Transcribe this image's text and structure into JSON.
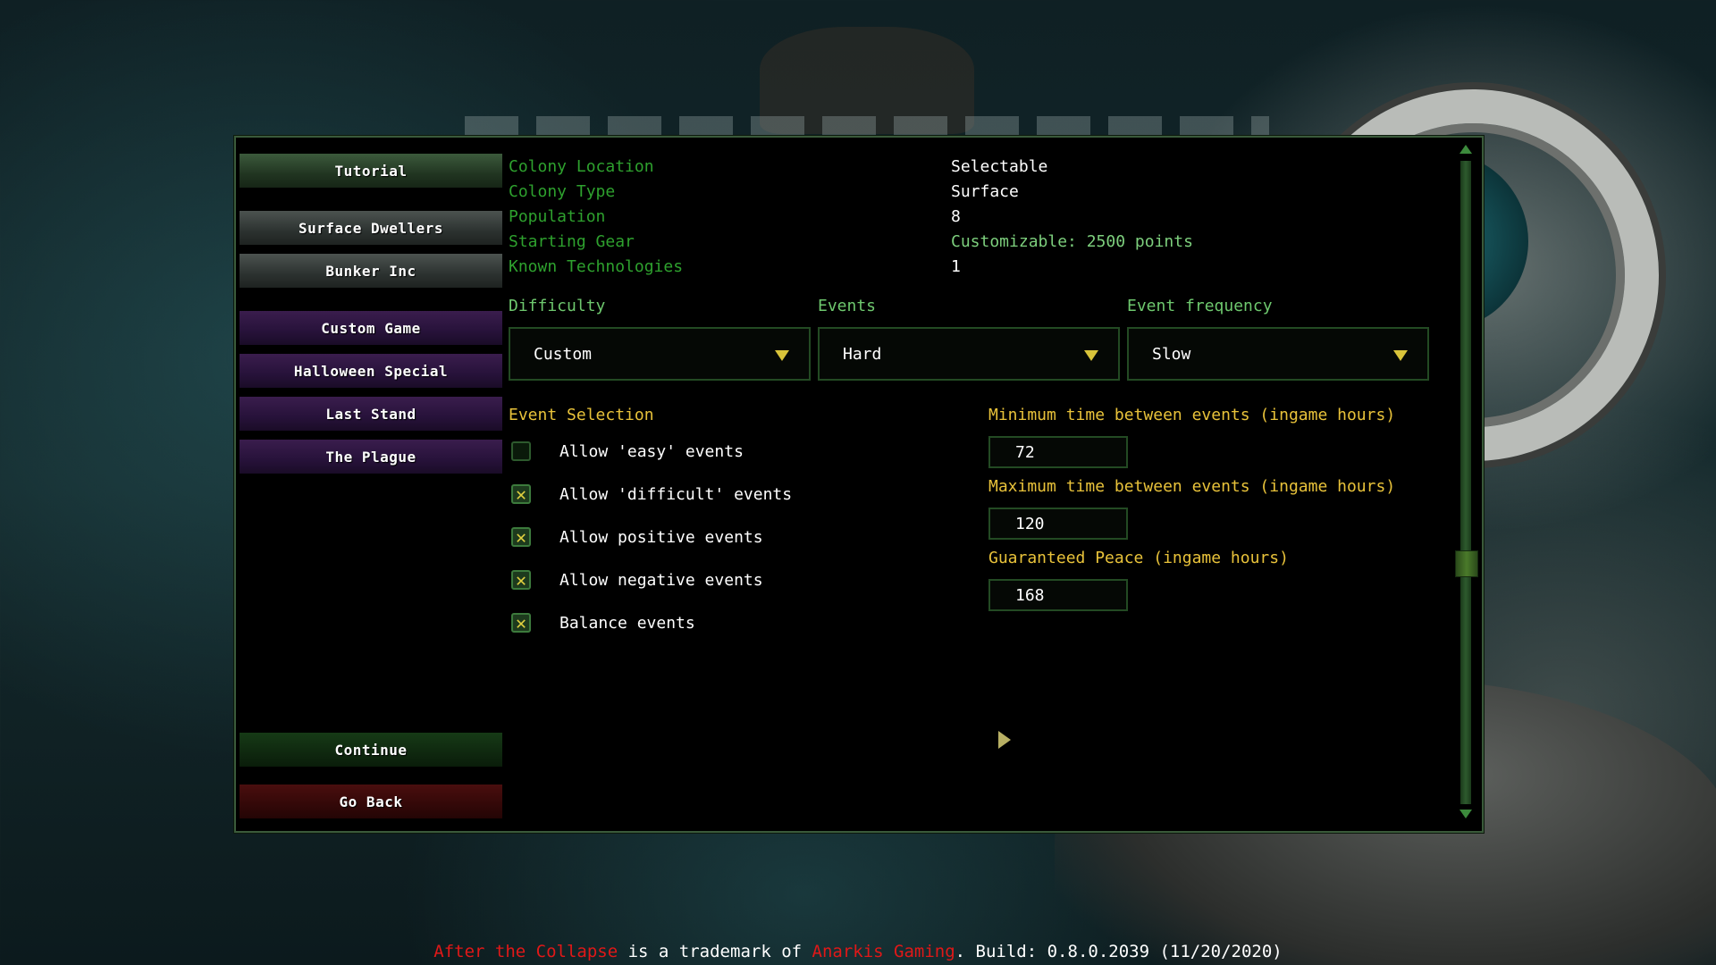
{
  "menu": {
    "tutorial": "Tutorial",
    "surface_dwellers": "Surface Dwellers",
    "bunker_inc": "Bunker Inc",
    "custom_game": "Custom Game",
    "halloween_special": "Halloween Special",
    "last_stand": "Last Stand",
    "the_plague": "The Plague",
    "continue": "Continue",
    "go_back": "Go Back"
  },
  "info": {
    "rows": [
      {
        "label": "Colony Location",
        "value": "Selectable"
      },
      {
        "label": "Colony Type",
        "value": "Surface"
      },
      {
        "label": "Population",
        "value": "8"
      },
      {
        "label": "Starting Gear",
        "value": "Customizable: 2500 points"
      },
      {
        "label": "Known Technologies",
        "value": "1"
      }
    ]
  },
  "settings": {
    "difficulty_label": "Difficulty",
    "difficulty_value": "Custom",
    "events_label": "Events",
    "events_value": "Hard",
    "frequency_label": "Event frequency",
    "frequency_value": "Slow"
  },
  "event_selection": {
    "title": "Event Selection",
    "options": [
      {
        "label": "Allow 'easy' events",
        "checked": false
      },
      {
        "label": "Allow 'difficult' events",
        "checked": true
      },
      {
        "label": "Allow positive events",
        "checked": true
      },
      {
        "label": "Allow negative events",
        "checked": true
      },
      {
        "label": "Balance events",
        "checked": true
      }
    ]
  },
  "timing": {
    "min_label": "Minimum time between events (ingame hours)",
    "min_value": "72",
    "max_label": "Maximum time between events (ingame hours)",
    "max_value": "120",
    "peace_label": "Guaranteed Peace (ingame hours)",
    "peace_value": "168"
  },
  "footer": {
    "game_name": "After the Collapse",
    "trademark_text": " is a trademark of ",
    "company": "Anarkis Gaming",
    "build_text": ". Build: 0.8.0.2039 (11/20/2020)"
  },
  "colors": {
    "label_green": "#2ea12e",
    "accent_yellow": "#e8c23a",
    "footer_red": "#e01818"
  }
}
